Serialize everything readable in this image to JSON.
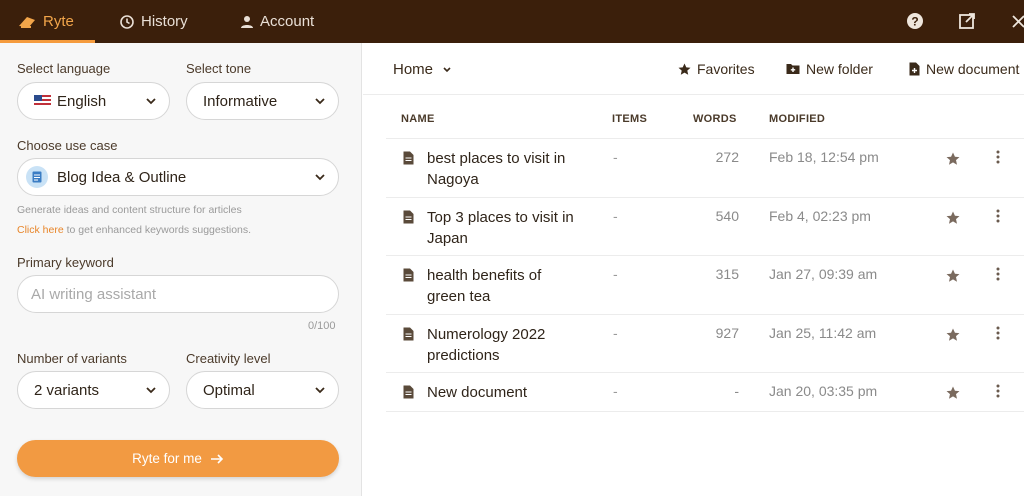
{
  "topbar": {
    "tabs": [
      {
        "label": "Ryte",
        "icon": "ryte-logo-icon",
        "active": true
      },
      {
        "label": "History",
        "icon": "history-icon"
      },
      {
        "label": "Account",
        "icon": "account-icon"
      }
    ],
    "accent": "#f59b3d",
    "background": "#3b1f0b"
  },
  "form": {
    "language_label": "Select language",
    "language_value": "English",
    "tone_label": "Select tone",
    "tone_value": "Informative",
    "usecase_label": "Choose use case",
    "usecase_value": "Blog Idea & Outline",
    "usecase_desc": "Generate ideas and content structure for articles",
    "hint_link": "Click here",
    "hint_rest": " to get enhanced keywords suggestions.",
    "keyword_label": "Primary keyword",
    "keyword_placeholder": "AI writing assistant",
    "keyword_counter": "0/100",
    "variants_label": "Number of variants",
    "variants_value": "2 variants",
    "creativity_label": "Creativity level",
    "creativity_value": "Optimal",
    "submit_label": "Ryte for me",
    "submit_color": "#f29a42"
  },
  "toolbar": {
    "breadcrumb": "Home",
    "favorites": "Favorites",
    "new_folder": "New folder",
    "new_document": "New document"
  },
  "table": {
    "headers": {
      "name": "NAME",
      "items": "ITEMS",
      "words": "WORDS",
      "modified": "MODIFIED"
    },
    "rows": [
      {
        "name": "best places to visit in Nagoya",
        "items": "-",
        "words": "272",
        "modified": "Feb 18, 12:54 pm"
      },
      {
        "name": "Top 3 places to visit in Japan",
        "items": "-",
        "words": "540",
        "modified": "Feb 4, 02:23 pm"
      },
      {
        "name": "health benefits of green tea",
        "items": "-",
        "words": "315",
        "modified": "Jan 27, 09:39 am"
      },
      {
        "name": "Numerology 2022 predictions",
        "items": "-",
        "words": "927",
        "modified": "Jan 25, 11:42 am"
      },
      {
        "name": "New document",
        "items": "-",
        "words": "-",
        "modified": "Jan 20, 03:35 pm"
      }
    ]
  }
}
